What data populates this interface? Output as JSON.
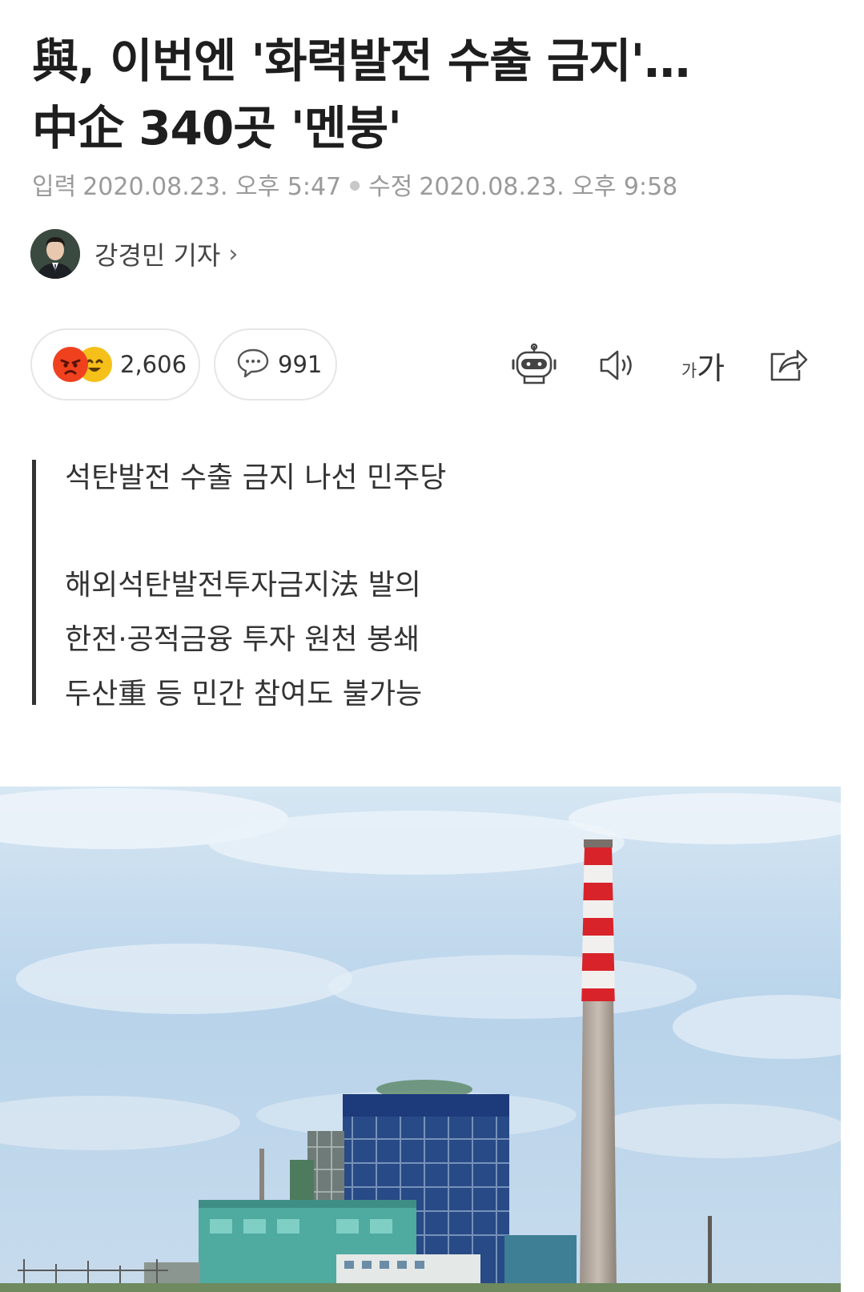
{
  "article": {
    "headline": [
      "與, 이번엔 '화력발전 수출 금지'…",
      "中企 340곳 '멘붕'"
    ],
    "meta": {
      "input_label": "입력",
      "input_datetime": "2020.08.23. 오후 5:47",
      "edit_label": "수정",
      "edit_datetime": "2020.08.23. 오후 9:58"
    },
    "author": {
      "name": "강경민 기자",
      "chevron": "›"
    }
  },
  "reactions": {
    "count": "2,606",
    "emojis": [
      "angry-emoji",
      "smile-emoji"
    ]
  },
  "comments": {
    "count": "991",
    "icon": "speech-bubble-icon"
  },
  "toolbar": {
    "font_size_small": "가",
    "font_size_large": "가",
    "icons": [
      "robot-summary-icon",
      "speaker-icon",
      "font-size-icon",
      "share-icon"
    ]
  },
  "summary": [
    "석탄발전 수출 금지 나선 민주당",
    "해외석탄발전투자금지法 발의",
    "한전·공적금융 투자 원천 봉쇄",
    "두산重 등 민간 참여도 불가능"
  ],
  "colors": {
    "angry": "#f0411f",
    "smile": "#f6c01a",
    "stack_red": "#d8232a",
    "building_blue": "#1d3b7a",
    "sky": "#b9d4ea"
  }
}
